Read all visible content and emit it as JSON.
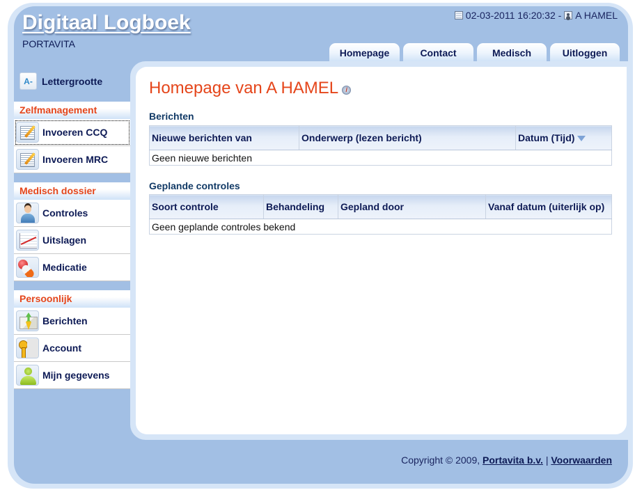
{
  "header": {
    "app_title": "Digitaal Logboek",
    "subtitle": "PORTAVITA",
    "datetime": "02-03-2011 16:20:32 -",
    "user": "A HAMEL",
    "calendar_icon": "calendar-icon",
    "user_icon": "user-icon"
  },
  "tabs": [
    {
      "label": "Homepage"
    },
    {
      "label": "Contact"
    },
    {
      "label": "Medisch"
    },
    {
      "label": "Uitloggen"
    }
  ],
  "sidebar": {
    "font_size": {
      "label": "Lettergrootte",
      "icon_text": "A-",
      "icon": "font-size-icon"
    },
    "groups": [
      {
        "title": "Zelfmanagement",
        "items": [
          {
            "label": "Invoeren CCQ",
            "icon": "edit-form-icon"
          },
          {
            "label": "Invoeren MRC",
            "icon": "edit-form-icon"
          }
        ]
      },
      {
        "title": "Medisch dossier",
        "items": [
          {
            "label": "Controles",
            "icon": "doctor-icon"
          },
          {
            "label": "Uitslagen",
            "icon": "chart-icon"
          },
          {
            "label": "Medicatie",
            "icon": "pills-icon"
          }
        ]
      },
      {
        "title": "Persoonlijk",
        "items": [
          {
            "label": "Berichten",
            "icon": "mail-icon"
          },
          {
            "label": "Account",
            "icon": "key-icon"
          },
          {
            "label": "Mijn gegevens",
            "icon": "person-icon"
          }
        ]
      }
    ]
  },
  "main": {
    "title": "Homepage van A HAMEL",
    "info_icon_text": "i",
    "messages": {
      "title": "Berichten",
      "columns": [
        "Nieuwe berichten van",
        "Onderwerp (lezen bericht)",
        "Datum (Tijd)"
      ],
      "empty_text": "Geen nieuwe berichten"
    },
    "checks": {
      "title": "Geplande controles",
      "columns": [
        "Soort controle",
        "Behandeling",
        "Gepland door",
        "Vanaf datum (uiterlijk op)"
      ],
      "empty_text": "Geen geplande controles bekend"
    }
  },
  "footer": {
    "copyright": "Copyright © 2009,",
    "company_link": "Portavita b.v.",
    "separator": "|",
    "terms_link": "Voorwaarden"
  }
}
